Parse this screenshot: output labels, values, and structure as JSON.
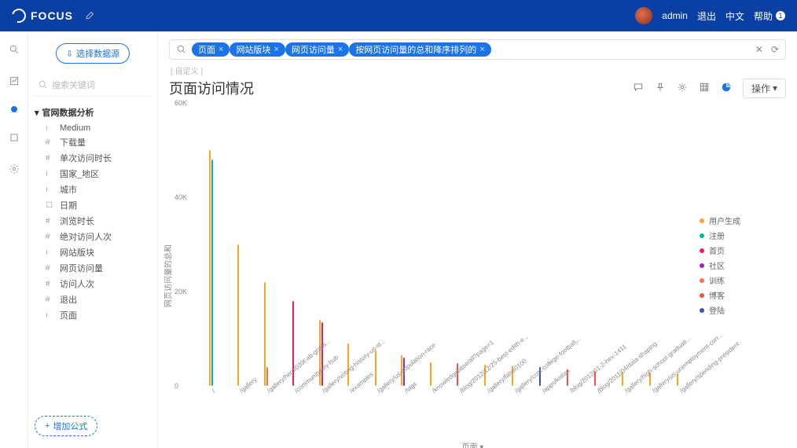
{
  "header": {
    "brand": "FOCUS",
    "user": "admin",
    "logout": "退出",
    "lang": "中文",
    "help": "帮助",
    "help_count": "1"
  },
  "sidebar": {
    "select_source": "选择数据源",
    "search_placeholder": "搜索关键词",
    "tree_head": "官网数据分析",
    "items": [
      {
        "icon": "T",
        "label": "Medium"
      },
      {
        "icon": "#",
        "label": "下载量"
      },
      {
        "icon": "#",
        "label": "单次访问时长"
      },
      {
        "icon": "T",
        "label": "国家_地区"
      },
      {
        "icon": "T",
        "label": "城市"
      },
      {
        "icon": "D",
        "label": "日期"
      },
      {
        "icon": "#",
        "label": "浏览时长"
      },
      {
        "icon": "#",
        "label": "绝对访问人次"
      },
      {
        "icon": "T",
        "label": "网站版块"
      },
      {
        "icon": "#",
        "label": "网页访问量"
      },
      {
        "icon": "#",
        "label": "访问人次"
      },
      {
        "icon": "#",
        "label": "退出"
      },
      {
        "icon": "T",
        "label": "页面"
      }
    ],
    "add_formula": "增加公式"
  },
  "search": {
    "tags": [
      "页面",
      "网站版块",
      "网页访问量",
      "按网页访问量的总和降序排列的"
    ],
    "solution_label": "[ 自定义 ]"
  },
  "title": "页面访问情况",
  "ops_label": "操作",
  "chart_data": {
    "type": "bar",
    "ylabel": "网页访问量的总和",
    "xlabel": "页面",
    "ylim": [
      0,
      60000
    ],
    "yticks": [
      "60K",
      "40K",
      "20K",
      "0"
    ],
    "legend": [
      {
        "name": "用户生成",
        "color": "#f5a623"
      },
      {
        "name": "注册",
        "color": "#00b8a9"
      },
      {
        "name": "首页",
        "color": "#e91e63"
      },
      {
        "name": "社区",
        "color": "#9c27b0"
      },
      {
        "name": "训练",
        "color": "#ff7043"
      },
      {
        "name": "博客",
        "color": "#ef5350"
      },
      {
        "name": "登陆",
        "color": "#3f51b5"
      }
    ],
    "categories": [
      "/",
      "/gallery",
      "/gallery/hero/039t-ab-grass...",
      "/community/my-hub",
      "/gallery/voting-history-us-st...",
      "/examples",
      "/gallery/us-population-race",
      "/tags",
      "/knowledgebase/all?page=1",
      "/blog/2012/12/25-best-edith-e...",
      "/gallery/false0100",
      "/gallery/cost-college-football...",
      "/apps/kistart",
      "/blog/2012/01-2-hex-1411",
      "/blog/2011/04/data-shaping",
      "/gallery/high-school-graduati...",
      "/gallery/us-unemployment-corr...",
      "/gallery/spending-president"
    ],
    "series_per_category": [
      [
        {
          "c": "#f5a623",
          "v": 50000
        },
        {
          "c": "#00b8a9",
          "v": 48000
        }
      ],
      [
        {
          "c": "#f5a623",
          "v": 30000
        }
      ],
      [
        {
          "c": "#f5a623",
          "v": 22000
        },
        {
          "c": "#ff7043",
          "v": 4000
        }
      ],
      [
        {
          "c": "#e91e63",
          "v": 18000
        }
      ],
      [
        {
          "c": "#f5a623",
          "v": 14000
        },
        {
          "c": "#e91e63",
          "v": 13500
        }
      ],
      [
        {
          "c": "#f5a623",
          "v": 9000
        }
      ],
      [
        {
          "c": "#f5a623",
          "v": 7500
        }
      ],
      [
        {
          "c": "#f5a623",
          "v": 6500
        },
        {
          "c": "#9c27b0",
          "v": 6000
        }
      ],
      [
        {
          "c": "#f5a623",
          "v": 5000
        }
      ],
      [
        {
          "c": "#ef5350",
          "v": 4800
        }
      ],
      [
        {
          "c": "#f5a623",
          "v": 4500
        }
      ],
      [
        {
          "c": "#f5a623",
          "v": 4200
        }
      ],
      [
        {
          "c": "#3f51b5",
          "v": 4000
        }
      ],
      [
        {
          "c": "#ef5350",
          "v": 3500
        }
      ],
      [
        {
          "c": "#ef5350",
          "v": 3200
        }
      ],
      [
        {
          "c": "#f5a623",
          "v": 3000
        }
      ],
      [
        {
          "c": "#f5a623",
          "v": 2800
        }
      ],
      [
        {
          "c": "#f5a623",
          "v": 2600
        }
      ]
    ]
  }
}
